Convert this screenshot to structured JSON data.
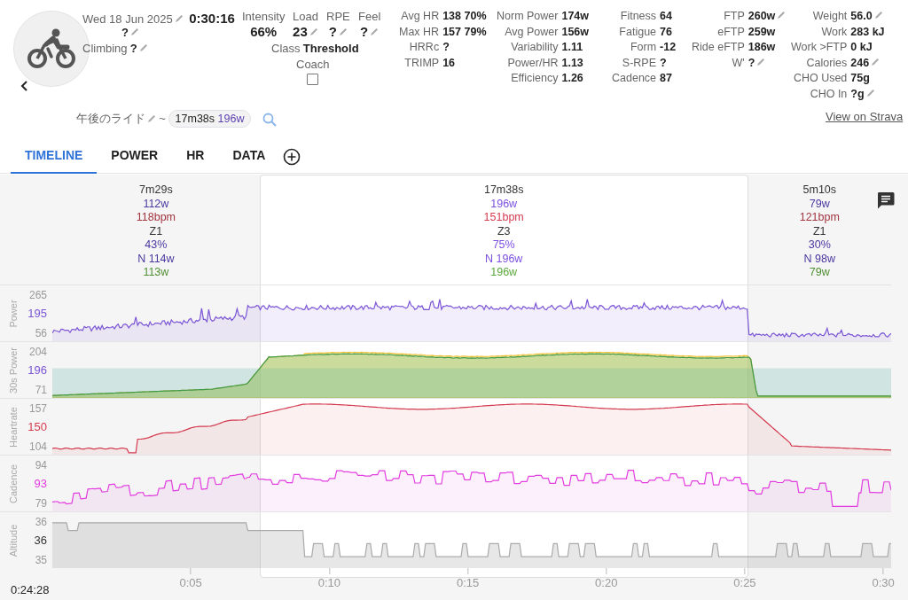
{
  "activity": {
    "date": "Wed 18 Jun 2025",
    "date_editable": true,
    "duration": "0:30:16",
    "note": "?",
    "note_editable": true,
    "climbing": {
      "label": "Climbing",
      "value": "?",
      "editable": true
    }
  },
  "metrics": [
    {
      "label": "Intensity",
      "value": "66%",
      "editable": false
    },
    {
      "label": "Load",
      "value": "23",
      "editable": true
    },
    {
      "label": "RPE",
      "value": "?",
      "editable": true
    },
    {
      "label": "Feel",
      "value": "?",
      "editable": true
    }
  ],
  "class": {
    "label": "Class",
    "value": "Threshold"
  },
  "coach": {
    "label": "Coach",
    "checked": false
  },
  "stat_columns": [
    [
      {
        "label": "Avg HR",
        "value": "138 70%",
        "editable": false
      },
      {
        "label": "Max HR",
        "value": "157 79%",
        "editable": false
      },
      {
        "label": "HRRc",
        "value": "?",
        "editable": false
      },
      {
        "label": "TRIMP",
        "value": "16",
        "editable": false
      }
    ],
    [
      {
        "label": "Norm Power",
        "value": "174w",
        "editable": false
      },
      {
        "label": "Avg Power",
        "value": "156w",
        "editable": false
      },
      {
        "label": "Variability",
        "value": "1.11",
        "editable": false
      },
      {
        "label": "Power/HR",
        "value": "1.13",
        "editable": false
      },
      {
        "label": "Efficiency",
        "value": "1.26",
        "editable": false
      }
    ],
    [
      {
        "label": "Fitness",
        "value": "64",
        "editable": false
      },
      {
        "label": "Fatigue",
        "value": "76",
        "editable": false
      },
      {
        "label": "Form",
        "value": "-12",
        "editable": false
      },
      {
        "label": "S-RPE",
        "value": "?",
        "editable": false
      },
      {
        "label": "Cadence",
        "value": "87",
        "editable": false
      }
    ],
    [
      {
        "label": "FTP",
        "value": "260w",
        "editable": true
      },
      {
        "label": "eFTP",
        "value": "259w",
        "editable": false
      },
      {
        "label": "Ride eFTP",
        "value": "186w",
        "editable": false
      },
      {
        "label": "W'",
        "value": "?",
        "editable": true
      }
    ],
    [
      {
        "label": "Weight",
        "value": "56.0",
        "editable": true
      },
      {
        "label": "Work",
        "value": "283 kJ",
        "editable": false
      },
      {
        "label": "Work >FTP",
        "value": "0 kJ",
        "editable": false
      },
      {
        "label": "Calories",
        "value": "246",
        "editable": true
      },
      {
        "label": "CHO Used",
        "value": "75g",
        "editable": false
      },
      {
        "label": "CHO In",
        "value": "?g",
        "editable": true
      }
    ]
  ],
  "name": {
    "text": "午後のライド",
    "editable": true,
    "separator": "~",
    "chip_duration": "17m38s",
    "chip_power": "196w"
  },
  "strava_link": "View on Strava",
  "tabs": [
    {
      "label": "TIMELINE",
      "selected": true
    },
    {
      "label": "POWER",
      "selected": false
    },
    {
      "label": "HR",
      "selected": false
    },
    {
      "label": "DATA",
      "selected": false
    }
  ],
  "intervals": [
    {
      "duration": "7m29s",
      "power": "112w",
      "heartrate": "118bpm",
      "zone": "Z1",
      "percent": "43%",
      "norm_power": "N 114w",
      "power_30s": "113w",
      "selected": false
    },
    {
      "duration": "17m38s",
      "power": "196w",
      "heartrate": "151bpm",
      "zone": "Z3",
      "percent": "75%",
      "norm_power": "N 196w",
      "power_30s": "196w",
      "selected": true
    },
    {
      "duration": "5m10s",
      "power": "79w",
      "heartrate": "121bpm",
      "zone": "Z1",
      "percent": "30%",
      "norm_power": "N 98w",
      "power_30s": "79w",
      "selected": false
    }
  ],
  "panels": [
    {
      "label": "Power",
      "kind": "power",
      "ticks": [
        "265",
        "195",
        "56"
      ],
      "color": "#7b55d6"
    },
    {
      "label": "30s Power",
      "kind": "smooth",
      "ticks": [
        "204",
        "196",
        "71"
      ],
      "color": "#7b55d6"
    },
    {
      "label": "Heartrate",
      "kind": "heartrate",
      "ticks": [
        "157",
        "150",
        "104"
      ],
      "color": "#d43a4e"
    },
    {
      "label": "Cadence",
      "kind": "cadence",
      "ticks": [
        "94",
        "93",
        "79"
      ],
      "color": "#e23de0"
    },
    {
      "label": "Altitude",
      "kind": "altitude",
      "ticks": [
        "36",
        "36",
        "35"
      ],
      "color": "#333333"
    }
  ],
  "time_axis": {
    "start": "0:24:28",
    "ticks": [
      "0:05",
      "0:10",
      "0:15",
      "0:20",
      "0:25",
      "0:30"
    ]
  }
}
